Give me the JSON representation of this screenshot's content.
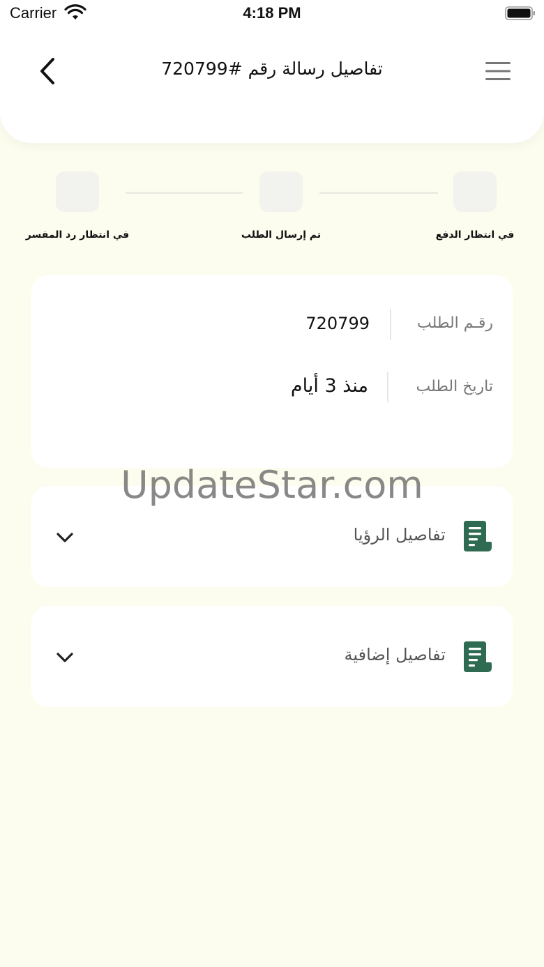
{
  "status_bar": {
    "carrier": "Carrier",
    "time": "4:18 PM"
  },
  "header": {
    "title": "تفاصيل رسالة رقم  #720799",
    "back_icon": "chevron-left-icon",
    "menu_icon": "hamburger-menu-icon"
  },
  "stepper": {
    "steps": [
      {
        "label": "في انتظار الدفع"
      },
      {
        "label": "تم إرسال الطلب"
      },
      {
        "label": "في انتظار رد المفسر"
      }
    ]
  },
  "order_info": {
    "order_number_label": "رقـم الطلب",
    "order_number_value": "720799",
    "order_date_label": "تاريخ الطلب",
    "order_date_value": "منذ 3 أيام"
  },
  "sections": [
    {
      "title": "تفاصيل الرؤيا",
      "icon": "document-icon"
    },
    {
      "title": "تفاصيل إضافية",
      "icon": "document-icon"
    }
  ],
  "watermark": "UpdateStar.com",
  "colors": {
    "background": "#FDFDEF",
    "card": "#FFFFFF",
    "accent_green": "#2F6B52",
    "step_inactive": "#F2F2EE"
  }
}
